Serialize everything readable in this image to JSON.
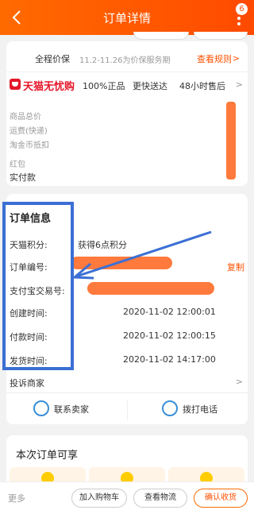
{
  "header": {
    "title": "订单详情",
    "back_glyph": "<",
    "badge": "6"
  },
  "price_protect": {
    "label": "全程价保",
    "desc": "11.2-11.26为价保服务期",
    "link": "查看规则",
    "arrow": ">"
  },
  "tmall": {
    "name": "天猫无忧购",
    "features": [
      "100%正品",
      "更快送达",
      "48小时售后"
    ],
    "arrow": ">"
  },
  "fees": [
    {
      "label": "商品总价",
      "value": "¥"
    },
    {
      "label": "运费(快递)",
      "value": "¥"
    },
    {
      "label": "淘金币抵扣",
      "value": "¥"
    },
    {
      "label": "红包",
      "value": "¥"
    },
    {
      "label": "实付款",
      "value": "¥"
    }
  ],
  "order_info": {
    "title": "订单信息",
    "rows": [
      {
        "label": "天猫积分:",
        "value": "获得6点积分"
      },
      {
        "label": "订单编号:",
        "value": ""
      },
      {
        "label": "支付宝交易号:",
        "value": ""
      },
      {
        "label": "创建时间:",
        "value": "2020-11-02 12:00:01"
      },
      {
        "label": "付款时间:",
        "value": "2020-11-02 12:00:15"
      },
      {
        "label": "发货时间:",
        "value": "2020-11-02 14:17:00"
      }
    ],
    "copy": "复制",
    "complain": "投诉商家",
    "contact_seller": "联系卖家",
    "call": "拨打电话"
  },
  "benefits": {
    "title": "本次订单可享"
  },
  "bottom": {
    "more": "更多",
    "add_cart": "加入购物车",
    "logistics": "查看物流",
    "confirm": "确认收货"
  },
  "colors": {
    "accent": "#ff5000",
    "header": "#ff6a00",
    "annotation": "#3b6fd4",
    "redaction": "#ff7a3c"
  }
}
